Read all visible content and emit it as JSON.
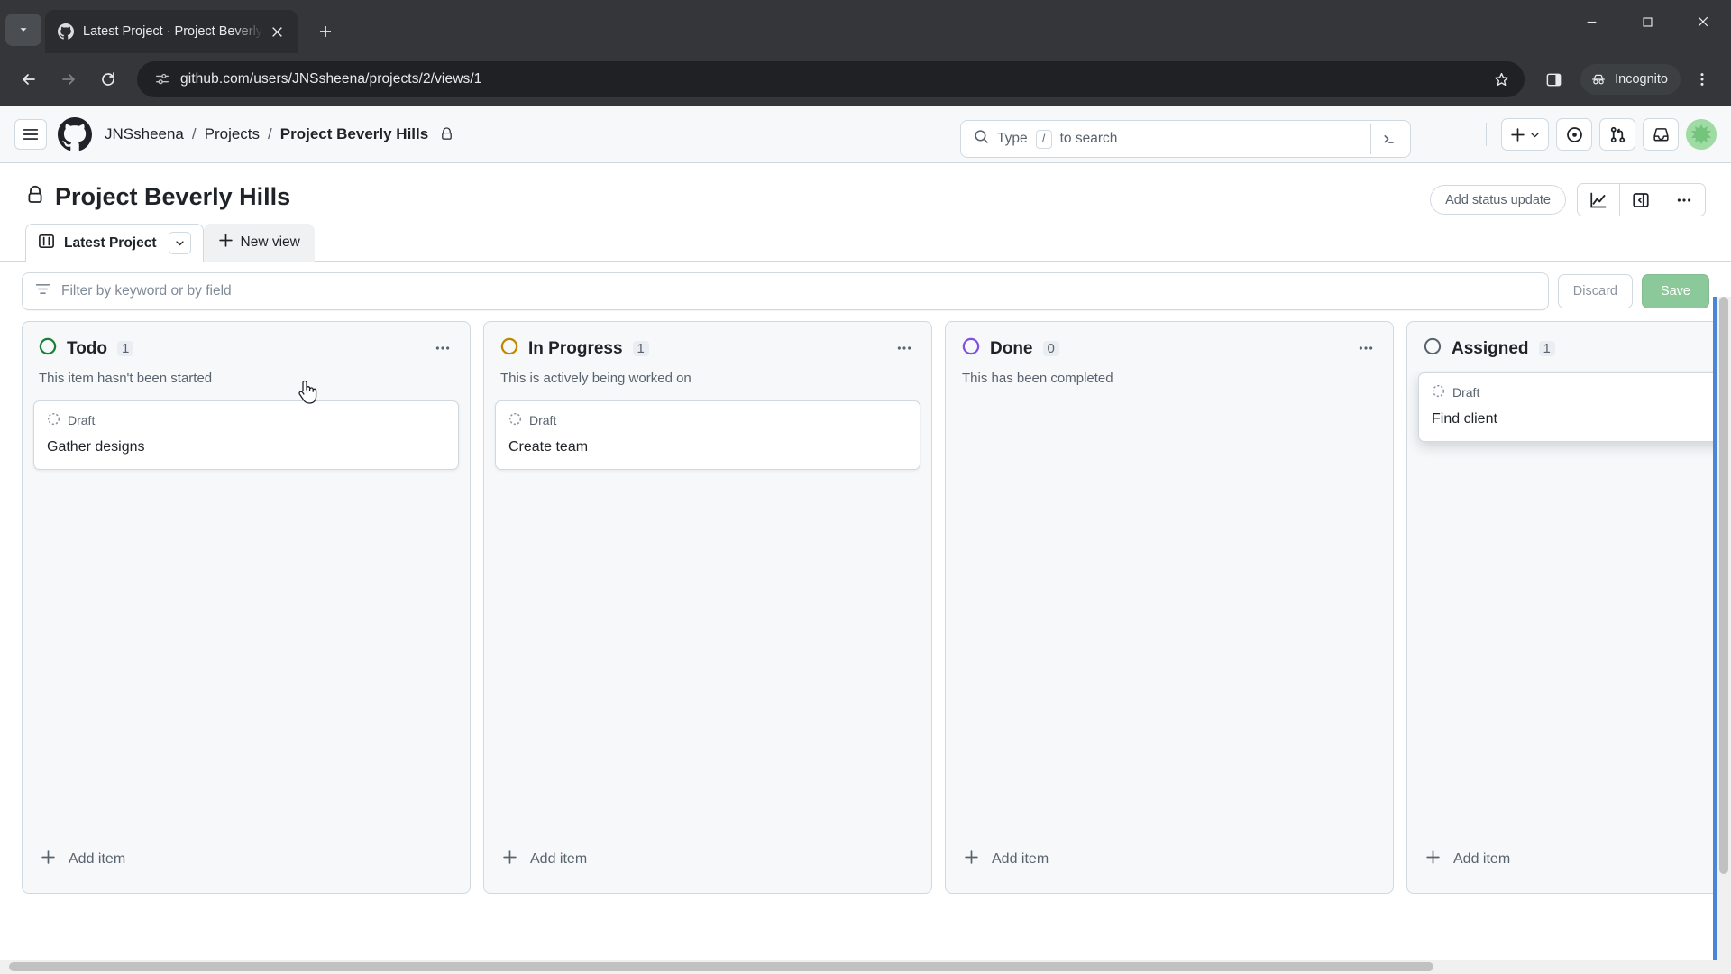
{
  "browser": {
    "tab": {
      "title": "Latest Project · Project Beverly H",
      "favicon_name": "github-favicon"
    },
    "new_tab_label": "+",
    "url": "github.com/users/JNSsheena/projects/2/views/1",
    "profile_label": "Incognito",
    "window_controls": [
      "minimize",
      "maximize",
      "close"
    ]
  },
  "github_header": {
    "breadcrumb": {
      "owner": "JNSsheena",
      "sep1": "/",
      "section": "Projects",
      "sep2": "/",
      "current": "Project Beverly Hills"
    },
    "search_placeholder": "Type",
    "search_key": "/",
    "search_suffix": "to search",
    "icons": [
      "hamburger-icon",
      "github-mark-icon",
      "plus-icon",
      "issues-icon",
      "pull-requests-icon",
      "inbox-icon",
      "avatar"
    ]
  },
  "project": {
    "title": "Project Beverly Hills",
    "visibility": "private",
    "add_status_update": "Add status update",
    "segmented": [
      "insights-icon",
      "panel-toggle-icon",
      "kebab-icon"
    ],
    "views": [
      {
        "label": "Latest Project",
        "icon": "board-view-icon",
        "active": true
      }
    ],
    "new_view_label": "New view"
  },
  "filter": {
    "placeholder": "Filter by keyword or by field",
    "value": "",
    "discard_label": "Discard",
    "save_label": "Save"
  },
  "board": {
    "columns": [
      {
        "name": "Todo",
        "count": "1",
        "description": "This item hasn't been started",
        "color": "#1a7f37",
        "cards": [
          {
            "badge": "Draft",
            "title": "Gather designs",
            "raised": false
          }
        ],
        "add_item_label": "Add item"
      },
      {
        "name": "In Progress",
        "count": "1",
        "description": "This is actively being worked on",
        "color": "#bf8700",
        "cards": [
          {
            "badge": "Draft",
            "title": "Create team",
            "raised": false
          }
        ],
        "add_item_label": "Add item"
      },
      {
        "name": "Done",
        "count": "0",
        "description": "This has been completed",
        "color": "#8250df",
        "cards": [],
        "add_item_label": "Add item"
      },
      {
        "name": "Assigned",
        "count": "1",
        "description": "",
        "color": "#59636e",
        "cards": [
          {
            "badge": "Draft",
            "title": "Find client",
            "raised": true
          }
        ],
        "add_item_label": "Add item"
      }
    ]
  },
  "colors": {
    "accent_green": "#8cc99a",
    "focus_blue": "#4a86d8",
    "chrome_dark": "#35363a",
    "gh_surface": "#f6f8fa",
    "gh_border": "#d1d9e0"
  }
}
